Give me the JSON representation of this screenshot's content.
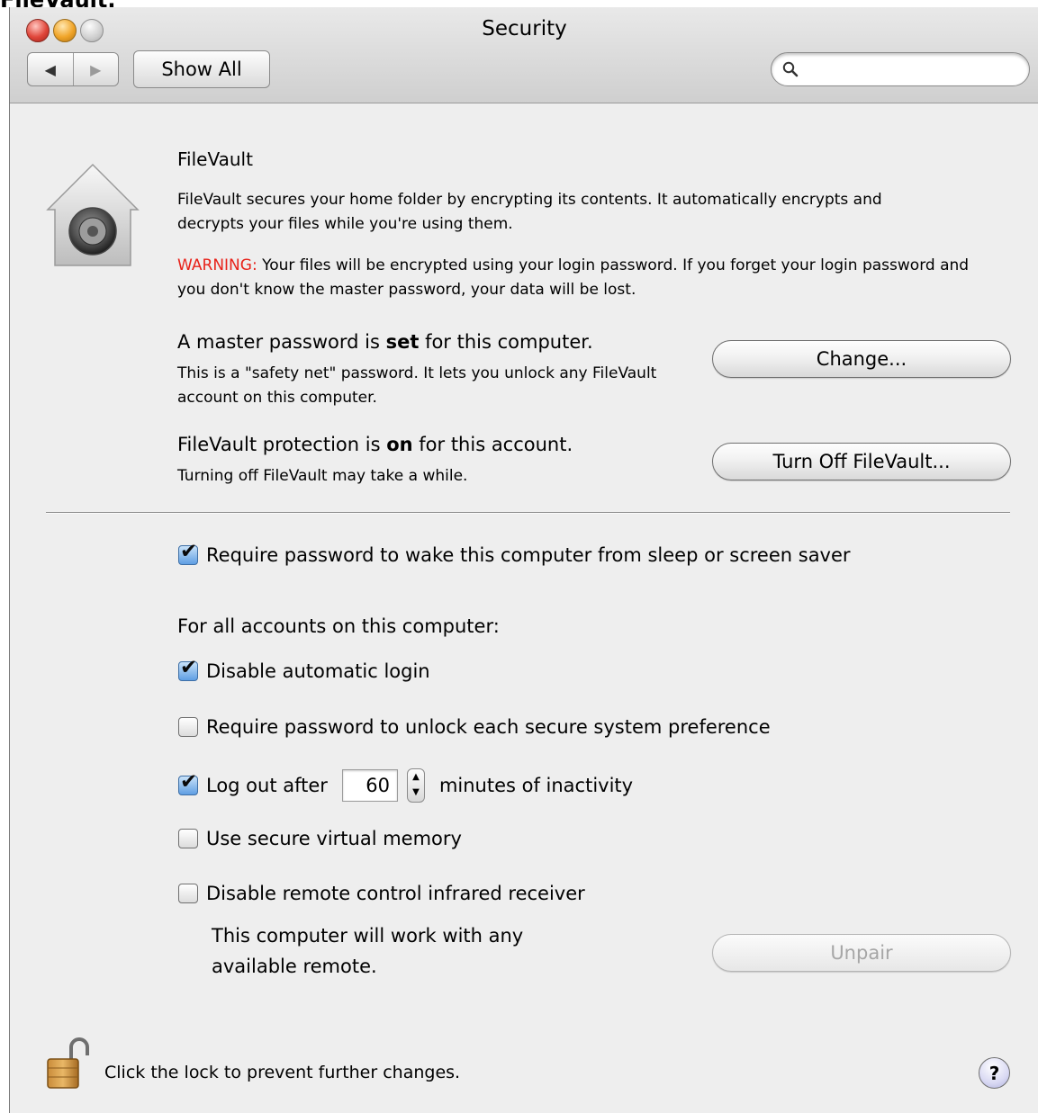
{
  "page_caption": "FileVault.",
  "window": {
    "title": "Security"
  },
  "toolbar": {
    "back_glyph": "◀",
    "forward_glyph": "▶",
    "show_all_label": "Show All",
    "search_value": "",
    "search_icon_glyph": "🔍"
  },
  "filevault": {
    "title": "FileVault",
    "description": "FileVault secures your home folder by encrypting its contents. It automatically encrypts and decrypts your files while you're using them.",
    "warning_label": "WARNING:",
    "warning_text": " Your files will be encrypted using your login password. If you forget your login password and you don't know the master password, your data will be lost.",
    "master": {
      "heading_pre": "A master password is ",
      "heading_bold": "set",
      "heading_post": " for this computer.",
      "detail": "This is a \"safety net\" password. It lets you unlock any FileVault account on this computer.",
      "button_label": "Change..."
    },
    "protection": {
      "heading_pre": "FileVault protection is ",
      "heading_bold": "on",
      "heading_post": " for this account.",
      "detail": "Turning off FileVault may take a while.",
      "button_label": "Turn Off FileVault..."
    }
  },
  "options": {
    "wake_password": {
      "label": "Require password to wake this computer from sleep or screen saver",
      "checked": true
    },
    "all_accounts_label": "For all accounts on this computer:",
    "disable_auto_login": {
      "label": "Disable automatic login",
      "checked": true
    },
    "unlock_pref": {
      "label": "Require password to unlock each secure system preference",
      "checked": false
    },
    "logout": {
      "label_pre": "Log out after",
      "minutes": "60",
      "label_post": "minutes of inactivity",
      "checked": true
    },
    "virtual_memory": {
      "label": "Use secure virtual memory",
      "checked": false
    },
    "infrared": {
      "label": "Disable remote control infrared receiver",
      "checked": false,
      "note_line1": "This computer will work with any",
      "note_line2": "available remote.",
      "unpair_label": "Unpair"
    }
  },
  "footer": {
    "lock_text": "Click the lock to prevent further changes.",
    "help_glyph": "?"
  }
}
